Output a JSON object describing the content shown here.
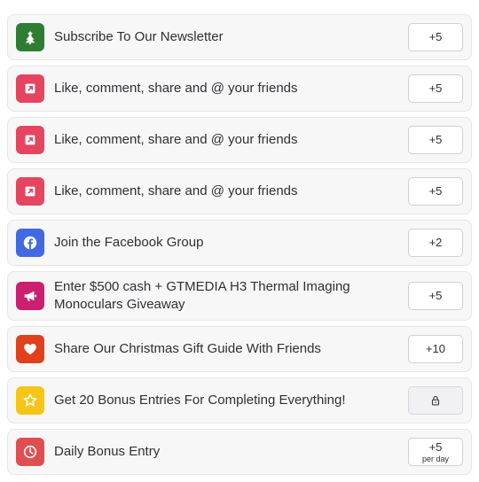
{
  "entries": [
    {
      "label": "Subscribe To Our Newsletter",
      "points": "+5",
      "icon": "christmas-tree-icon",
      "color": "#2f7d32"
    },
    {
      "label": "Like, comment, share and @ your friends",
      "points": "+5",
      "icon": "external-link-icon",
      "color": "#e5455f"
    },
    {
      "label": "Like, comment, share and @ your friends",
      "points": "+5",
      "icon": "external-link-icon",
      "color": "#e5455f"
    },
    {
      "label": "Like, comment, share and @ your friends",
      "points": "+5",
      "icon": "external-link-icon",
      "color": "#e5455f"
    },
    {
      "label": "Join the Facebook Group",
      "points": "+2",
      "icon": "facebook-icon",
      "color": "#4169e1"
    },
    {
      "label": "Enter $500 cash + GTMEDIA H3 Thermal Imaging Monoculars Giveaway",
      "points": "+5",
      "icon": "megaphone-icon",
      "color": "#cc1f6f"
    },
    {
      "label": "Share Our Christmas Gift Guide With Friends",
      "points": "+10",
      "icon": "heart-icon",
      "color": "#e0401b"
    },
    {
      "label": "Get 20 Bonus Entries For Completing Everything!",
      "points": "",
      "icon": "star-icon",
      "color": "#f5c518",
      "locked": true
    },
    {
      "label": "Daily Bonus Entry",
      "points": "+5",
      "points_sub": "per day",
      "icon": "clock-icon",
      "color": "#e04f4f"
    }
  ]
}
